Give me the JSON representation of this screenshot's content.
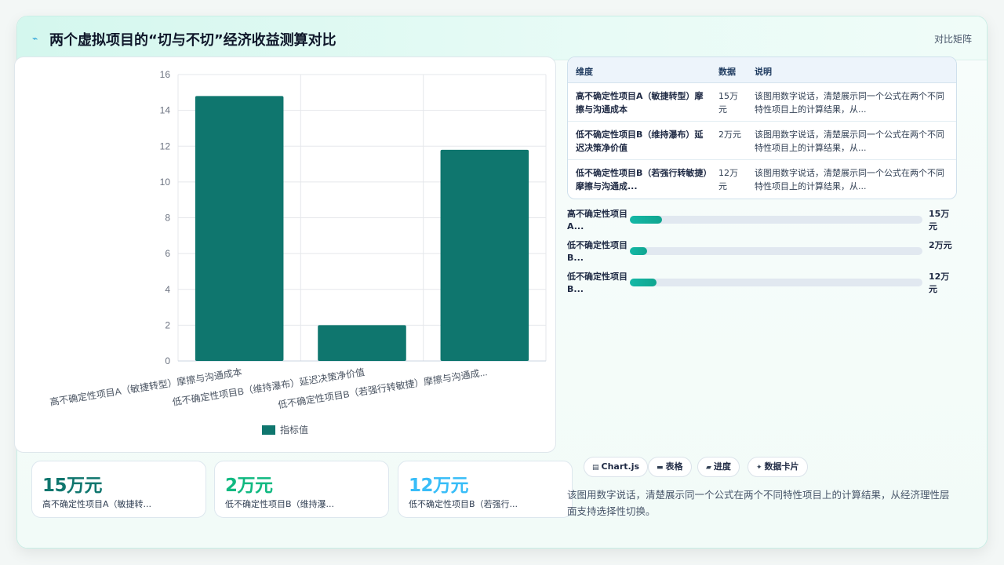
{
  "header": {
    "title": "两个虚拟项目的“切与不切”经济收益测算对比",
    "tag": "对比矩阵",
    "icon": "lightning-icon"
  },
  "chart_data": {
    "type": "bar",
    "categories": [
      "高不确定性项目A（敏捷转型）摩擦与沟通成本",
      "低不确定性项目B（维持瀑布）延迟决策净价值",
      "低不确定性项目B（若强行转敏捷）摩擦与沟通成..."
    ],
    "series": [
      {
        "name": "指标值",
        "values": [
          14.8,
          2.0,
          11.8
        ],
        "color": "#0f766e"
      }
    ],
    "ylim": [
      0,
      16
    ],
    "yticks": [
      0,
      2,
      4,
      6,
      8,
      10,
      12,
      14,
      16
    ],
    "legend": "bottom",
    "grid": true
  },
  "table": {
    "headers": [
      "维度",
      "数据",
      "说明"
    ],
    "rows": [
      {
        "dim": "高不确定性项目A（敏捷转型）摩擦与沟通成本",
        "val": "15万元",
        "desc": "该图用数字说话，清楚展示同一个公式在两个不同特性项目上的计算结果，从..."
      },
      {
        "dim": "低不确定性项目B（维持瀑布）延迟决策净价值",
        "val": "2万元",
        "desc": "该图用数字说话，清楚展示同一个公式在两个不同特性项目上的计算结果，从..."
      },
      {
        "dim": "低不确定性项目B（若强行转敏捷）摩擦与沟通成...",
        "val": "12万元",
        "desc": "该图用数字说话，清楚展示同一个公式在两个不同特性项目上的计算结果，从..."
      }
    ]
  },
  "progress": [
    {
      "label": "高不确定性项目A...",
      "value": "15万元",
      "fraction": 0.11
    },
    {
      "label": "低不确定性项目B...",
      "value": "2万元",
      "fraction": 0.06
    },
    {
      "label": "低不确定性项目B...",
      "value": "12万元",
      "fraction": 0.09
    }
  ],
  "kpis": [
    {
      "num": "15万元",
      "label": "高不确定性项目A（敏捷转...",
      "color": "#0f766e"
    },
    {
      "num": "2万元",
      "label": "低不确定性项目B（维持瀑...",
      "color": "#10b981"
    },
    {
      "num": "12万元",
      "label": "低不确定性项目B（若强行...",
      "color": "#38bdf8"
    }
  ],
  "chips": [
    {
      "icon": "chart-icon",
      "glyph": "▤",
      "label": "Chart.js"
    },
    {
      "icon": "table-icon",
      "glyph": "▬",
      "label": "表格"
    },
    {
      "icon": "progress-icon",
      "glyph": "▰",
      "label": "进度"
    },
    {
      "icon": "sparkle-icon",
      "glyph": "✦",
      "label": "数据卡片"
    }
  ],
  "footnote": "该图用数字说话，清楚展示同一个公式在两个不同特性项目上的计算结果，从经济理性层面支持选择性切换。"
}
